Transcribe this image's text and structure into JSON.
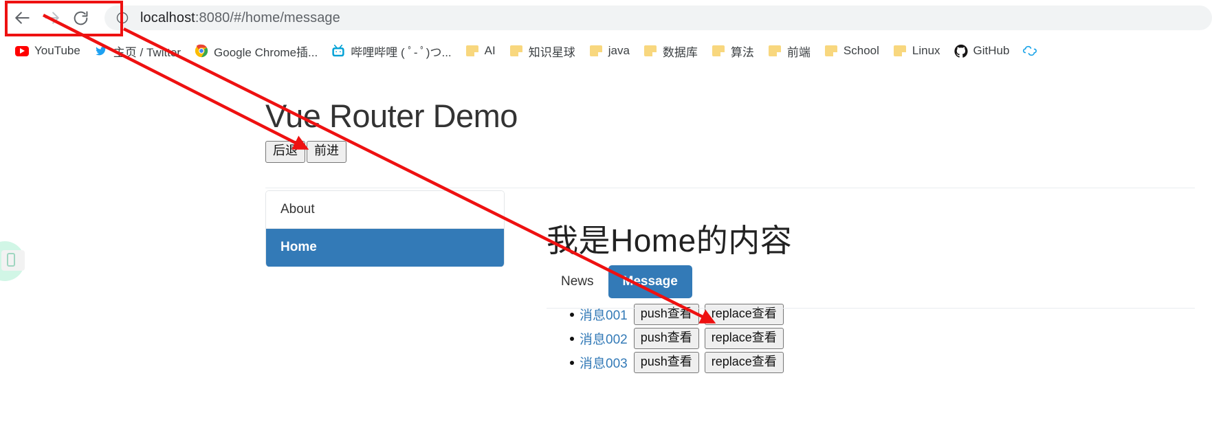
{
  "browser": {
    "back_icon": "arrow-left-icon",
    "forward_icon": "arrow-right-icon",
    "reload_icon": "reload-icon",
    "site_info_icon": "info-circle-icon",
    "url_scheme_host": "localhost",
    "url_rest": ":8080/#/home/message",
    "url_full": "localhost:8080/#/home/message",
    "bookmarks": [
      {
        "label": "YouTube",
        "icon": "youtube-icon"
      },
      {
        "label": "主页 / Twitter",
        "icon": "twitter-icon"
      },
      {
        "label": "Google Chrome插...",
        "icon": "chrome-icon"
      },
      {
        "label": "哔哩哔哩 ( ﾟ- ﾟ)つ...",
        "icon": "bilibili-icon"
      },
      {
        "label": "AI",
        "icon": "folder-icon"
      },
      {
        "label": "知识星球",
        "icon": "folder-icon"
      },
      {
        "label": "java",
        "icon": "folder-icon"
      },
      {
        "label": "数据库",
        "icon": "folder-icon"
      },
      {
        "label": "算法",
        "icon": "folder-icon"
      },
      {
        "label": "前端",
        "icon": "folder-icon"
      },
      {
        "label": "School",
        "icon": "folder-icon"
      },
      {
        "label": "Linux",
        "icon": "folder-icon"
      },
      {
        "label": "GitHub",
        "icon": "github-icon"
      },
      {
        "label": "",
        "icon": "cloud-icon"
      }
    ]
  },
  "page": {
    "title": "Vue Router Demo",
    "history_buttons": [
      {
        "label": "后退"
      },
      {
        "label": "前进"
      }
    ],
    "nav_list": [
      {
        "label": "About",
        "active": false
      },
      {
        "label": "Home",
        "active": true
      }
    ],
    "content_heading": "我是Home的内容",
    "tabs": [
      {
        "label": "News",
        "active": false
      },
      {
        "label": "Message",
        "active": true
      }
    ],
    "messages": [
      {
        "link": "消息001",
        "push_label": "push查看",
        "replace_label": "replace查看"
      },
      {
        "link": "消息002",
        "push_label": "push查看",
        "replace_label": "replace查看"
      },
      {
        "link": "消息003",
        "push_label": "push查看",
        "replace_label": "replace查看"
      }
    ]
  },
  "annotations": {
    "highlight_box_color": "#ee1111",
    "arrow_color": "#ee1111",
    "note": "red rectangle around browser back/forward/reload buttons with two arrows pointing from it"
  },
  "colors": {
    "accent_blue": "#337ab7",
    "link_blue": "#337ab7",
    "button_face": "#efefef",
    "omnibox_bg": "#f1f3f4",
    "annotation_red": "#ee1111"
  }
}
